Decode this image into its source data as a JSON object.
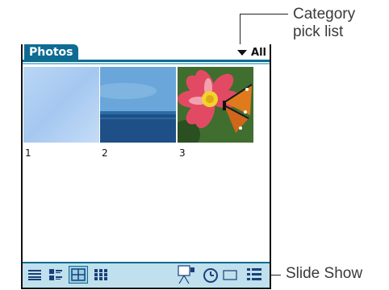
{
  "callouts": {
    "category_line1": "Category",
    "category_line2": "pick list",
    "slide_show": "Slide Show"
  },
  "app": {
    "title": "Photos",
    "category": "All"
  },
  "photos": [
    {
      "label": "1",
      "icon": "photo-light-blue"
    },
    {
      "label": "2",
      "icon": "photo-sky-sea"
    },
    {
      "label": "3",
      "icon": "photo-flower-butterfly"
    }
  ],
  "toolbar": {
    "buttons": [
      "list-view-icon",
      "detail-view-icon",
      "thumbnail-view-icon",
      "small-thumbnail-view-icon",
      "slide-show-icon",
      "timer-icon",
      "details-icon"
    ],
    "selected": "thumbnail-view-icon"
  },
  "colors": {
    "title_bar": "#0e6c93",
    "accent_light": "#7cc2d8",
    "toolbar_bg": "#bfe0ec"
  }
}
